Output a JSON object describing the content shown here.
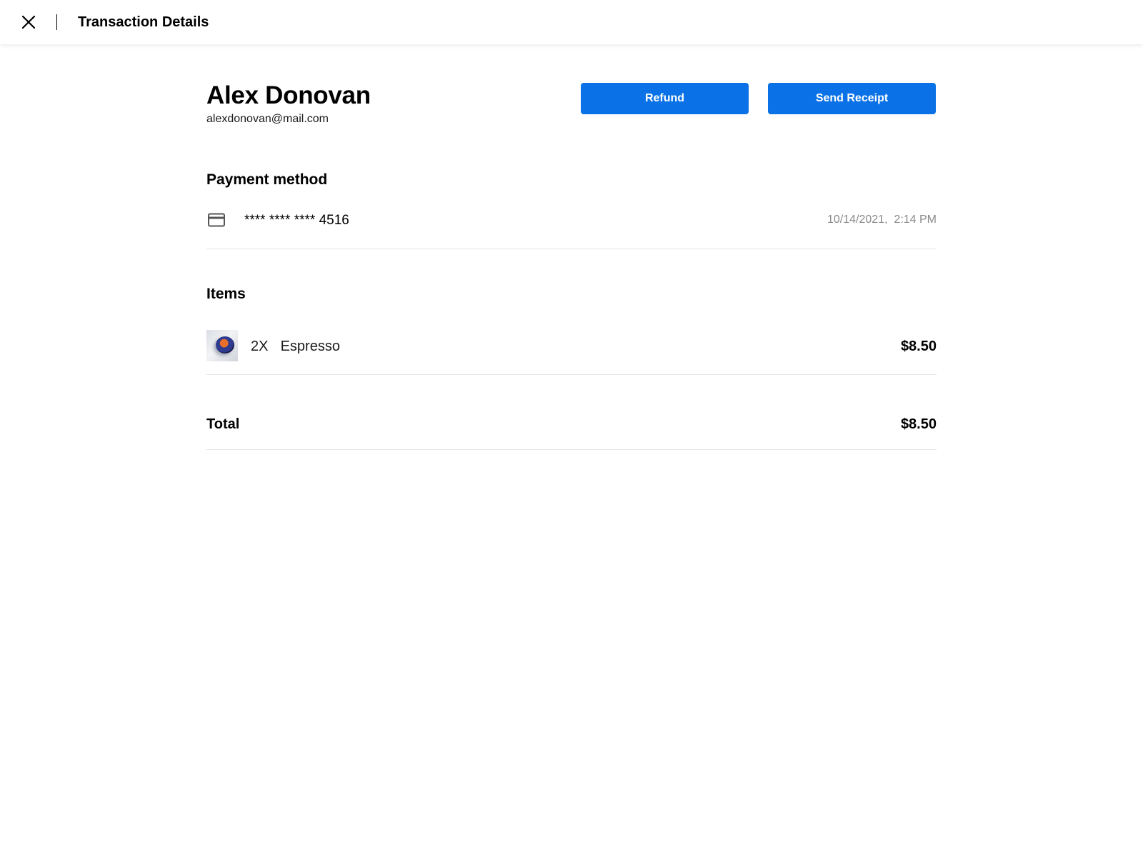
{
  "header": {
    "title": "Transaction Details",
    "close_icon": "close-icon"
  },
  "customer": {
    "name": "Alex Donovan",
    "email": "alexdonovan@mail.com"
  },
  "actions": {
    "refund_label": "Refund",
    "send_receipt_label": "Send Receipt",
    "button_color": "#0a72e6"
  },
  "payment": {
    "heading": "Payment method",
    "card_icon": "credit-card-icon",
    "card_number": "**** **** **** 4516",
    "date": "10/14/2021,  2:14 PM"
  },
  "items": {
    "heading": "Items",
    "list": [
      {
        "thumbnail_icon": "espresso-thumbnail",
        "name": "2X  Espresso",
        "price": "$8.50"
      }
    ]
  },
  "total": {
    "label": "Total",
    "value": "$8.50"
  }
}
